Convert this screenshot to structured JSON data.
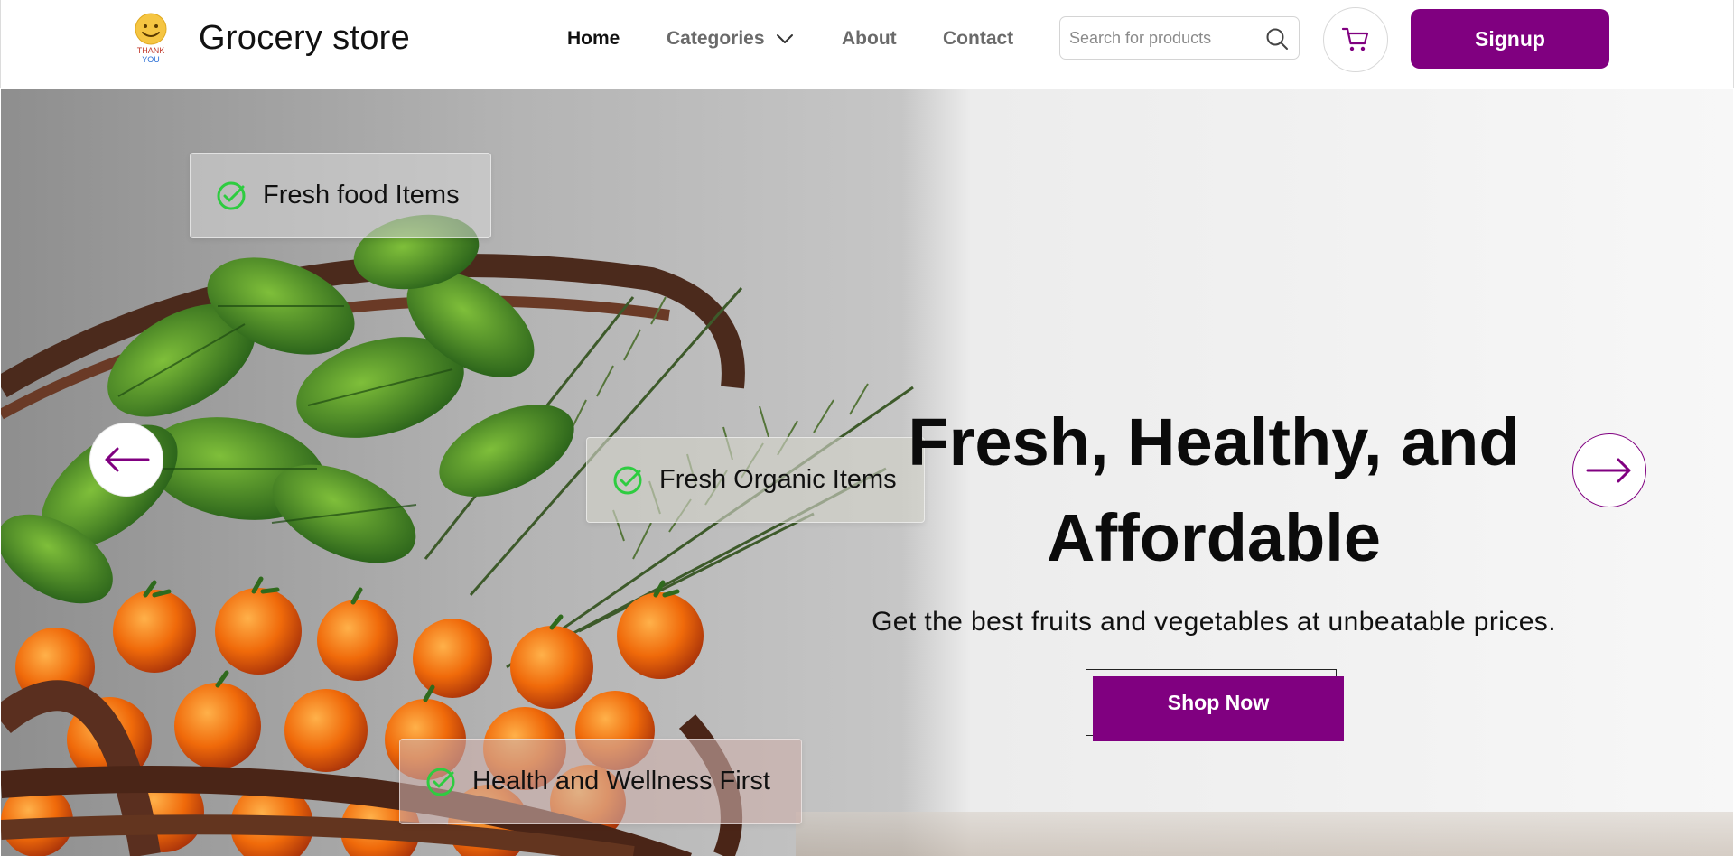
{
  "header": {
    "logo_text_top": "THANK",
    "logo_text_bottom": "YOU",
    "brand": "Grocery store",
    "nav": {
      "home": "Home",
      "categories": "Categories",
      "about": "About",
      "contact": "Contact"
    },
    "search": {
      "placeholder": "Search for products",
      "value": ""
    },
    "signup_label": "Signup"
  },
  "hero": {
    "features": [
      {
        "label": "Fresh food Items"
      },
      {
        "label": "Fresh Organic Items"
      },
      {
        "label": "Health and Wellness First"
      }
    ],
    "title_line1": "Fresh, Healthy, and",
    "title_line2": "Affordable",
    "subtitle": "Get the best fruits and vegetables at unbeatable prices.",
    "cta_label": "Shop Now"
  },
  "icons": {
    "logo": "smiley-thank-you-logo",
    "categories_chevron": "chevron-down-icon",
    "search": "search-icon",
    "cart": "shopping-cart-icon",
    "feature_check": "check-circle-icon",
    "prev": "arrow-left-icon",
    "next": "arrow-right-icon"
  },
  "colors": {
    "brand_purple": "#800080",
    "check_green": "#2ecc40",
    "text_dark": "#111111",
    "nav_muted": "#6a6a6a"
  }
}
